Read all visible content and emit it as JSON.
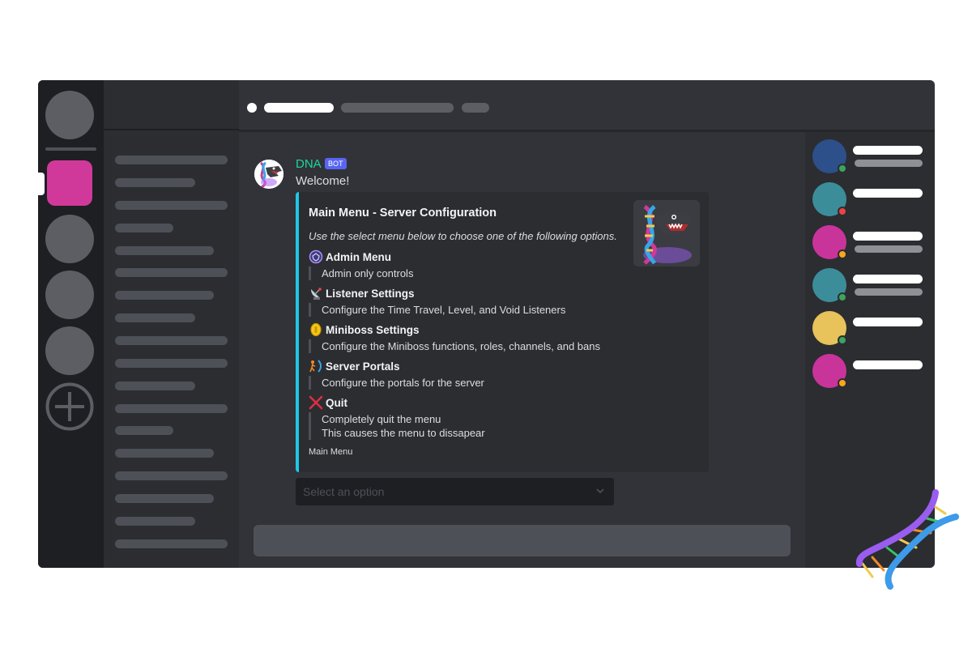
{
  "message": {
    "author": "DNA",
    "bot_tag": "BOT",
    "content": "Welcome!"
  },
  "embed": {
    "accent_color": "#1ec8e6",
    "title": "Main Menu - Server Configuration",
    "description": "Use the select menu below to choose one of the following options.",
    "fields": [
      {
        "icon": "admin-shield-icon",
        "name": "Admin Menu",
        "lines": [
          "Admin only controls"
        ]
      },
      {
        "icon": "satellite-dish-icon",
        "name": "Listener Settings",
        "lines": [
          "Configure the Time Travel, Level, and Void Listeners"
        ]
      },
      {
        "icon": "gold-coin-icon",
        "name": "Miniboss Settings",
        "lines": [
          "Configure the Miniboss functions, roles, channels, and bans"
        ]
      },
      {
        "icon": "portal-icon",
        "name": "Server Portals",
        "lines": [
          "Configure the portals for the server"
        ]
      },
      {
        "icon": "red-x-icon",
        "name": "Quit",
        "lines": [
          "Completely quit the menu",
          "This causes the menu to dissapear"
        ]
      }
    ],
    "footer": "Main Menu"
  },
  "select_menu": {
    "placeholder": "Select an option"
  },
  "colors": {
    "author": "#1dd6a0",
    "bot_tag": "#5865f2",
    "active_server": "#d0399a"
  },
  "member_status_colors": [
    "#3ba55d",
    "#ed4245",
    "#faa61a",
    "#3ba55d",
    "#3ba55d",
    "#faa61a"
  ]
}
